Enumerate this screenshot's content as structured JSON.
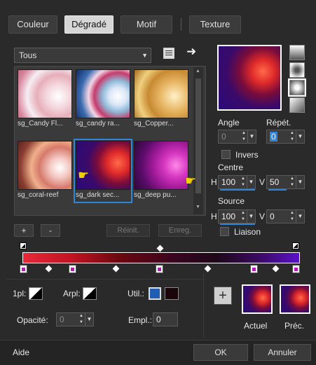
{
  "tabs": {
    "couleur": "Couleur",
    "degrade": "Dégradé",
    "motif": "Motif",
    "texture": "Texture"
  },
  "category_select": {
    "value": "Tous"
  },
  "gradients": [
    {
      "label": "sg_Candy Fl..."
    },
    {
      "label": "sg_candy ra..."
    },
    {
      "label": "sg_Copper..."
    },
    {
      "label": "sg_coral-reef"
    },
    {
      "label": "sg_dark sec..."
    },
    {
      "label": "sg_deep pu..."
    }
  ],
  "list_buttons": {
    "add": "+",
    "remove": "-",
    "reset": "Réinit.",
    "save": "Enreg."
  },
  "angle": {
    "label": "Angle",
    "value": "0"
  },
  "repeat": {
    "label": "Répét.",
    "value": "0"
  },
  "invert": {
    "label": "Invers"
  },
  "centre": {
    "label": "Centre",
    "h_label": "H",
    "h_value": "100",
    "v_label": "V",
    "v_value": "50"
  },
  "source": {
    "label": "Source",
    "h_label": "H",
    "h_value": "100",
    "v_label": "V",
    "v_value": "0"
  },
  "link": {
    "label": "Liaison"
  },
  "stops": {
    "fore_label": "1pl:",
    "back_label": "Arpl:",
    "user_label": "Util.:",
    "opacity_label": "Opacité:",
    "opacity_value": "0",
    "location_label": "Empl.:",
    "location_value": "0",
    "user_color": "#1e5fb4",
    "user_color2": "#1a0508"
  },
  "preview": {
    "current_label": "Actuel",
    "previous_label": "Préc.",
    "add_symbol": "+"
  },
  "footer": {
    "help": "Aide",
    "ok": "OK",
    "cancel": "Annuler"
  },
  "colors": {
    "accent": "#2f86d8",
    "stop_marker": "#b21bb0",
    "bg": "#2a2a2a"
  }
}
